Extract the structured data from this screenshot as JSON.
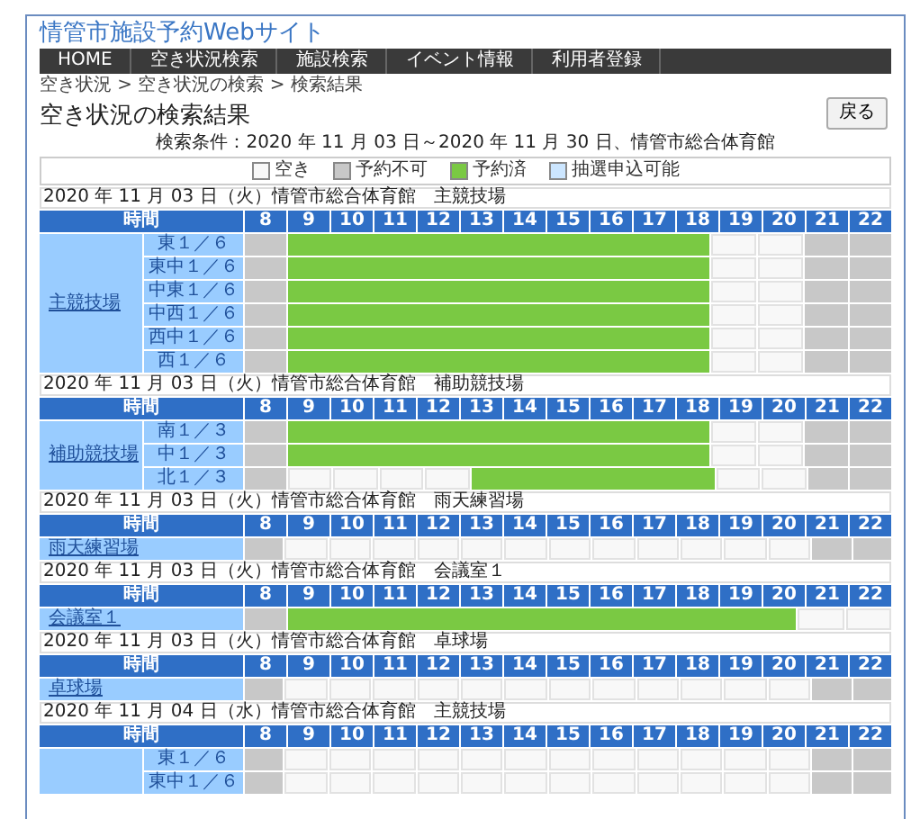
{
  "site_title": "情管市施設予約Webサイト",
  "nav": [
    {
      "label": "HOME"
    },
    {
      "label": "空き状況検索"
    },
    {
      "label": "施設検索"
    },
    {
      "label": "イベント情報"
    },
    {
      "label": "利用者登録"
    }
  ],
  "breadcrumb": "空き状況 > 空き状況の検索 > 検索結果",
  "page_title": "空き状況の検索結果",
  "back_button": "戻る",
  "search_conditions": "検索条件：2020 年 11 月 03 日～2020 年 11 月 30 日、情管市総合体育館",
  "legend": [
    {
      "label": "空き",
      "color": "#f8f8f8"
    },
    {
      "label": "予約不可",
      "color": "#c8c8c8"
    },
    {
      "label": "予約済",
      "color": "#7ac943"
    },
    {
      "label": "抽選申込可能",
      "color": "#cce6ff"
    }
  ],
  "sections": [
    {
      "heading": "2020 年 11 月 03 日（火）情管市総合体育館　主競技場",
      "time_label": "時間",
      "hours": [
        "8",
        "9",
        "10",
        "11",
        "12",
        "13",
        "14",
        "15",
        "16",
        "17",
        "18",
        "19",
        "20",
        "21",
        "22"
      ],
      "facility": "主競技場",
      "rows": [
        {
          "court": "東１／６",
          "slots": [
            {
              "kind": "closed"
            },
            {
              "kind": "booked"
            },
            {
              "kind": "booked"
            },
            {
              "kind": "booked"
            },
            {
              "kind": "booked"
            },
            {
              "kind": "booked"
            },
            {
              "kind": "booked"
            },
            {
              "kind": "booked"
            },
            {
              "kind": "booked"
            },
            {
              "kind": "booked"
            },
            {
              "kind": "booked"
            },
            {
              "kind": "free"
            },
            {
              "kind": "free"
            },
            {
              "kind": "closed"
            },
            {
              "kind": "closed"
            }
          ]
        },
        {
          "court": "東中１／６",
          "slots": [
            {
              "kind": "closed"
            },
            {
              "kind": "booked"
            },
            {
              "kind": "booked"
            },
            {
              "kind": "booked"
            },
            {
              "kind": "booked"
            },
            {
              "kind": "booked"
            },
            {
              "kind": "booked"
            },
            {
              "kind": "booked"
            },
            {
              "kind": "booked"
            },
            {
              "kind": "booked"
            },
            {
              "kind": "booked"
            },
            {
              "kind": "free"
            },
            {
              "kind": "free"
            },
            {
              "kind": "closed"
            },
            {
              "kind": "closed"
            }
          ]
        },
        {
          "court": "中東１／６",
          "slots": [
            {
              "kind": "closed"
            },
            {
              "kind": "booked"
            },
            {
              "kind": "booked"
            },
            {
              "kind": "booked"
            },
            {
              "kind": "booked"
            },
            {
              "kind": "booked"
            },
            {
              "kind": "booked"
            },
            {
              "kind": "booked"
            },
            {
              "kind": "booked"
            },
            {
              "kind": "booked"
            },
            {
              "kind": "booked"
            },
            {
              "kind": "free"
            },
            {
              "kind": "free"
            },
            {
              "kind": "closed"
            },
            {
              "kind": "closed"
            }
          ]
        },
        {
          "court": "中西１／６",
          "slots": [
            {
              "kind": "closed"
            },
            {
              "kind": "booked"
            },
            {
              "kind": "booked"
            },
            {
              "kind": "booked"
            },
            {
              "kind": "booked"
            },
            {
              "kind": "booked"
            },
            {
              "kind": "booked"
            },
            {
              "kind": "booked"
            },
            {
              "kind": "booked"
            },
            {
              "kind": "booked"
            },
            {
              "kind": "booked"
            },
            {
              "kind": "free"
            },
            {
              "kind": "free"
            },
            {
              "kind": "closed"
            },
            {
              "kind": "closed"
            }
          ]
        },
        {
          "court": "西中１／６",
          "slots": [
            {
              "kind": "closed"
            },
            {
              "kind": "booked"
            },
            {
              "kind": "booked"
            },
            {
              "kind": "booked"
            },
            {
              "kind": "booked"
            },
            {
              "kind": "booked"
            },
            {
              "kind": "booked"
            },
            {
              "kind": "booked"
            },
            {
              "kind": "booked"
            },
            {
              "kind": "booked"
            },
            {
              "kind": "booked"
            },
            {
              "kind": "free"
            },
            {
              "kind": "free"
            },
            {
              "kind": "closed"
            },
            {
              "kind": "closed"
            }
          ]
        },
        {
          "court": "西１／６",
          "slots": [
            {
              "kind": "closed"
            },
            {
              "kind": "booked"
            },
            {
              "kind": "booked"
            },
            {
              "kind": "booked"
            },
            {
              "kind": "booked"
            },
            {
              "kind": "booked"
            },
            {
              "kind": "booked"
            },
            {
              "kind": "booked"
            },
            {
              "kind": "booked"
            },
            {
              "kind": "booked"
            },
            {
              "kind": "booked"
            },
            {
              "kind": "free"
            },
            {
              "kind": "free"
            },
            {
              "kind": "closed"
            },
            {
              "kind": "closed"
            }
          ]
        }
      ]
    },
    {
      "heading": "2020 年 11 月 03 日（火）情管市総合体育館　補助競技場",
      "time_label": "時間",
      "hours": [
        "8",
        "9",
        "10",
        "11",
        "12",
        "13",
        "14",
        "15",
        "16",
        "17",
        "18",
        "19",
        "20",
        "21",
        "22"
      ],
      "facility": "補助競技場",
      "rows": [
        {
          "court": "南１／３",
          "slots": [
            {
              "kind": "closed"
            },
            {
              "kind": "booked"
            },
            {
              "kind": "booked"
            },
            {
              "kind": "booked"
            },
            {
              "kind": "booked"
            },
            {
              "kind": "booked"
            },
            {
              "kind": "booked"
            },
            {
              "kind": "booked"
            },
            {
              "kind": "booked"
            },
            {
              "kind": "booked"
            },
            {
              "kind": "booked"
            },
            {
              "kind": "free"
            },
            {
              "kind": "free"
            },
            {
              "kind": "closed"
            },
            {
              "kind": "closed"
            }
          ]
        },
        {
          "court": "中１／３",
          "slots": [
            {
              "kind": "closed"
            },
            {
              "kind": "booked"
            },
            {
              "kind": "booked"
            },
            {
              "kind": "booked"
            },
            {
              "kind": "booked"
            },
            {
              "kind": "booked"
            },
            {
              "kind": "booked"
            },
            {
              "kind": "booked"
            },
            {
              "kind": "booked"
            },
            {
              "kind": "booked"
            },
            {
              "kind": "booked"
            },
            {
              "kind": "free"
            },
            {
              "kind": "free"
            },
            {
              "kind": "closed"
            },
            {
              "kind": "closed"
            }
          ]
        },
        {
          "court": "北１／３",
          "slots": [
            {
              "kind": "closed"
            },
            {
              "kind": "free"
            },
            {
              "kind": "free"
            },
            {
              "kind": "free"
            },
            {
              "kind": "free"
            },
            {
              "kind": "booked"
            },
            {
              "kind": "booked"
            },
            {
              "kind": "booked"
            },
            {
              "kind": "booked"
            },
            {
              "kind": "booked"
            },
            {
              "kind": "booked"
            },
            {
              "kind": "free"
            },
            {
              "kind": "free"
            },
            {
              "kind": "closed"
            },
            {
              "kind": "closed"
            }
          ]
        }
      ]
    },
    {
      "heading": "2020 年 11 月 03 日（火）情管市総合体育館　雨天練習場",
      "time_label": "時間",
      "hours": [
        "8",
        "9",
        "10",
        "11",
        "12",
        "13",
        "14",
        "15",
        "16",
        "17",
        "18",
        "19",
        "20",
        "21",
        "22"
      ],
      "facility": "雨天練習場",
      "rows": [
        {
          "slots": [
            {
              "kind": "closed"
            },
            {
              "kind": "free"
            },
            {
              "kind": "free"
            },
            {
              "kind": "free"
            },
            {
              "kind": "free"
            },
            {
              "kind": "free"
            },
            {
              "kind": "free"
            },
            {
              "kind": "free"
            },
            {
              "kind": "free"
            },
            {
              "kind": "free"
            },
            {
              "kind": "free"
            },
            {
              "kind": "free"
            },
            {
              "kind": "free"
            },
            {
              "kind": "closed"
            },
            {
              "kind": "closed"
            }
          ]
        }
      ]
    },
    {
      "heading": "2020 年 11 月 03 日（火）情管市総合体育館　会議室１",
      "time_label": "時間",
      "hours": [
        "8",
        "9",
        "10",
        "11",
        "12",
        "13",
        "14",
        "15",
        "16",
        "17",
        "18",
        "19",
        "20",
        "21",
        "22"
      ],
      "facility": "会議室１",
      "rows": [
        {
          "slots": [
            {
              "kind": "closed"
            },
            {
              "kind": "booked"
            },
            {
              "kind": "booked"
            },
            {
              "kind": "booked"
            },
            {
              "kind": "booked"
            },
            {
              "kind": "booked"
            },
            {
              "kind": "booked"
            },
            {
              "kind": "booked"
            },
            {
              "kind": "booked"
            },
            {
              "kind": "booked"
            },
            {
              "kind": "booked"
            },
            {
              "kind": "booked"
            },
            {
              "kind": "booked"
            },
            {
              "kind": "free"
            },
            {
              "kind": "free"
            }
          ]
        }
      ]
    },
    {
      "heading": "2020 年 11 月 03 日（火）情管市総合体育館　卓球場",
      "time_label": "時間",
      "hours": [
        "8",
        "9",
        "10",
        "11",
        "12",
        "13",
        "14",
        "15",
        "16",
        "17",
        "18",
        "19",
        "20",
        "21",
        "22"
      ],
      "facility": "卓球場",
      "rows": [
        {
          "slots": [
            {
              "kind": "closed"
            },
            {
              "kind": "free"
            },
            {
              "kind": "free"
            },
            {
              "kind": "free"
            },
            {
              "kind": "free"
            },
            {
              "kind": "free"
            },
            {
              "kind": "free"
            },
            {
              "kind": "free"
            },
            {
              "kind": "free"
            },
            {
              "kind": "free"
            },
            {
              "kind": "free"
            },
            {
              "kind": "free"
            },
            {
              "kind": "free"
            },
            {
              "kind": "closed"
            },
            {
              "kind": "closed"
            }
          ]
        }
      ]
    },
    {
      "heading": "2020 年 11 月 04 日（水）情管市総合体育館　主競技場",
      "time_label": "時間",
      "hours": [
        "8",
        "9",
        "10",
        "11",
        "12",
        "13",
        "14",
        "15",
        "16",
        "17",
        "18",
        "19",
        "20",
        "21",
        "22"
      ],
      "rows": [
        {
          "court": "東１／６",
          "slots": [
            {
              "kind": "closed"
            },
            {
              "kind": "free"
            },
            {
              "kind": "free"
            },
            {
              "kind": "free"
            },
            {
              "kind": "free"
            },
            {
              "kind": "free"
            },
            {
              "kind": "free"
            },
            {
              "kind": "free"
            },
            {
              "kind": "free"
            },
            {
              "kind": "free"
            },
            {
              "kind": "free"
            },
            {
              "kind": "free"
            },
            {
              "kind": "free"
            },
            {
              "kind": "closed"
            },
            {
              "kind": "closed"
            }
          ]
        },
        {
          "court": "東中１／６",
          "slots": [
            {
              "kind": "closed"
            },
            {
              "kind": "free"
            },
            {
              "kind": "free"
            },
            {
              "kind": "free"
            },
            {
              "kind": "free"
            },
            {
              "kind": "free"
            },
            {
              "kind": "free"
            },
            {
              "kind": "free"
            },
            {
              "kind": "free"
            },
            {
              "kind": "free"
            },
            {
              "kind": "free"
            },
            {
              "kind": "free"
            },
            {
              "kind": "free"
            },
            {
              "kind": "closed"
            },
            {
              "kind": "closed"
            }
          ]
        }
      ]
    }
  ]
}
